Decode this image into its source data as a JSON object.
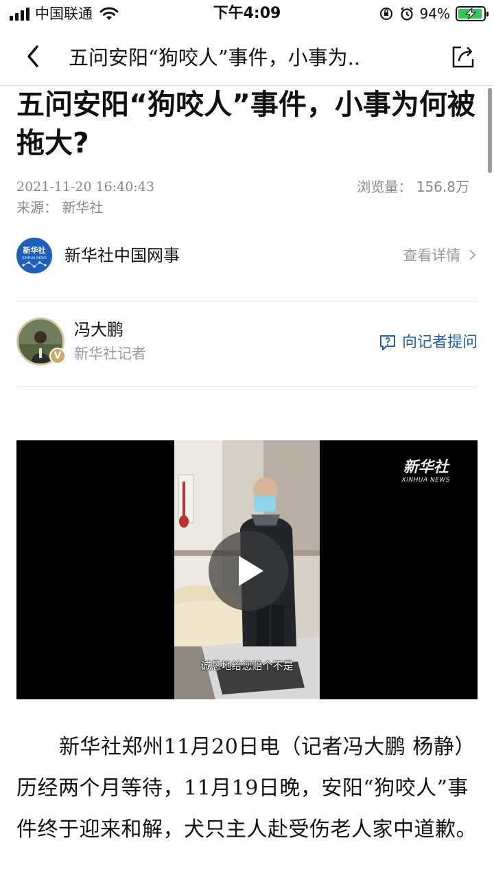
{
  "status_bar": {
    "carrier": "中国联通",
    "time": "下午4:09",
    "battery_text": "94%",
    "battery_level": 0.94
  },
  "nav": {
    "title": "五问安阳“狗咬人”事件，小事为..",
    "back_icon": "chevron-left-icon",
    "share_icon": "share-icon"
  },
  "article": {
    "headline": "五问安阳“狗咬人”事件，小事为何被拖大?",
    "date": "2021-11-20 16:40:43",
    "views_label": "浏览量：",
    "views_value": "156.8万",
    "source": "来源：  新华社"
  },
  "channel": {
    "name": "新华社中国网事",
    "detail": "查看详情"
  },
  "author": {
    "name": "冯大鹏",
    "role": "新华社记者",
    "badge": "V",
    "ask_label": "向记者提问"
  },
  "video": {
    "watermark_cn": "新华社",
    "watermark_en": "XINHUA NEWS",
    "subtitle": "诚恳地给您赔个不是"
  },
  "body": {
    "paragraph": "新华社郑州11月20日电（记者冯大鹏 杨静）历经两个月等待，11月19日晚，安阳“狗咬人”事件终于迎来和解，犬只主人赴受伤老人家中道歉。"
  },
  "colors": {
    "accent": "#1f5fa6",
    "meta_gray": "#888888",
    "battery_green": "#34c759"
  }
}
